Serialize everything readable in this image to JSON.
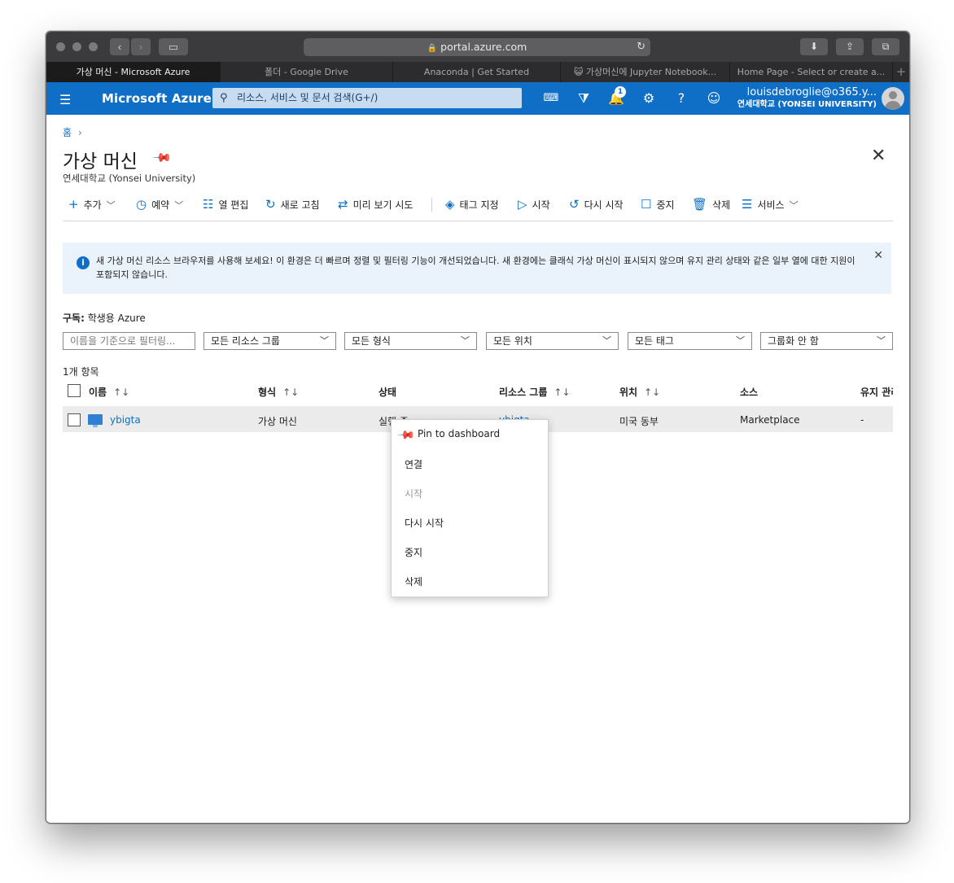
{
  "browser": {
    "url": "portal.azure.com",
    "tabs": [
      "가상 머신 - Microsoft Azure",
      "폴더 - Google Drive",
      "Anaconda | Get Started",
      "😺 가상머신에 Jupyter Notebook...",
      "Home Page - Select or create a..."
    ]
  },
  "header": {
    "brand": "Microsoft Azure",
    "search_placeholder": "리소스, 서비스 및 문서 검색(G+/)",
    "notification_count": "1",
    "user_email": "louisdebroglie@o365.y...",
    "user_org": "연세대학교 (YONSEI UNIVERSITY)"
  },
  "breadcrumb": {
    "home": "홈"
  },
  "page": {
    "title": "가상 머신",
    "subtitle": "연세대학교 (Yonsei University)"
  },
  "toolbar": {
    "add": "추가",
    "schedule": "예약",
    "edit_columns": "열 편집",
    "refresh": "새로 고침",
    "preview": "미리 보기 시도",
    "assign_tags": "태그 지정",
    "start": "시작",
    "restart": "다시 시작",
    "stop": "중지",
    "delete": "삭제",
    "services": "서비스"
  },
  "banner": {
    "text": "새 가상 머신 리소스 브라우저를 사용해 보세요! 이 환경은 더 빠르며 정렬 및 필터링 기능이 개선되었습니다. 새 환경에는 클래식 가상 머신이 표시되지 않으며 유지 관리 상태와 같은 일부 열에 대한 지원이 포함되지 않습니다."
  },
  "subscription": {
    "label": "구독:",
    "value": "학생용 Azure"
  },
  "filters": {
    "name_placeholder": "이름을 기준으로 필터링...",
    "resource_group": "모든 리소스 그룹",
    "type": "모든 형식",
    "location": "모든 위치",
    "tags": "모든 태그",
    "grouping": "그룹화 안 함"
  },
  "table": {
    "count": "1개 항목",
    "columns": [
      "이름",
      "형식",
      "상태",
      "리소스 그룹",
      "위치",
      "소스",
      "유지 관리"
    ],
    "rows": [
      {
        "name": "ybigta",
        "type": "가상 머신",
        "status": "실행 중",
        "resource_group": "ybigta",
        "location": "미국 동부",
        "source": "Marketplace",
        "maintenance": "-"
      }
    ]
  },
  "context_menu": {
    "items": [
      "Pin to dashboard",
      "연결",
      "시작",
      "다시 시작",
      "중지",
      "삭제"
    ]
  },
  "colors": {
    "azure_blue": "#0f6fc6",
    "banner_bg": "#eaf3fc",
    "mac_titlebar": "#3b3b3d"
  }
}
